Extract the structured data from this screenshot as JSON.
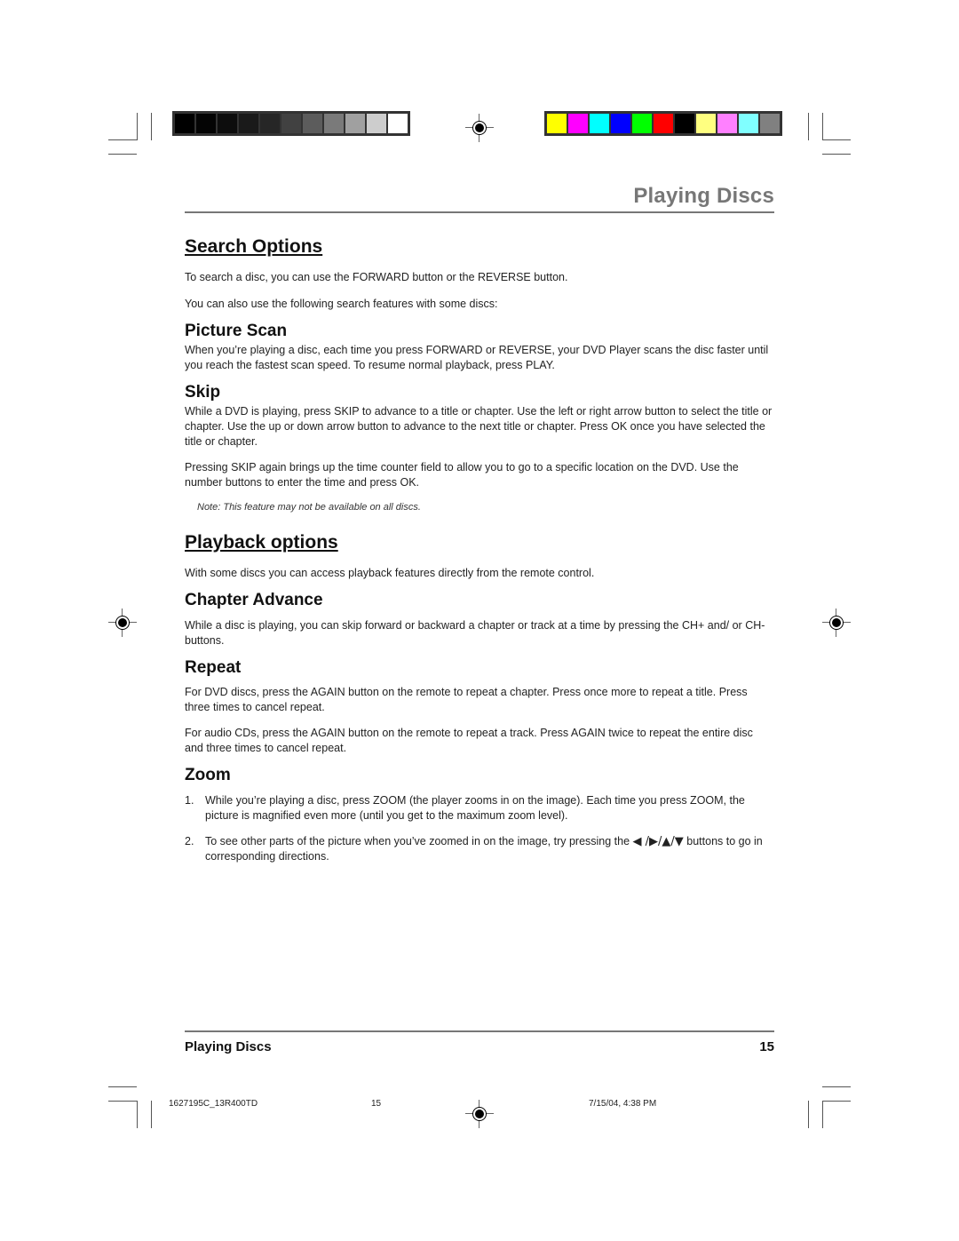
{
  "color_bars": {
    "grayscale": [
      "#000000",
      "#040404",
      "#0d0d0d",
      "#1a1a1a",
      "#262626",
      "#414141",
      "#5c5c5c",
      "#7a7a7a",
      "#a0a0a0",
      "#cdcdcd",
      "#ffffff"
    ],
    "process": [
      "#ffff00",
      "#ff00ff",
      "#00ffff",
      "#0000ff",
      "#00ff00",
      "#ff0000",
      "#000000",
      "#ffff80",
      "#ff80ff",
      "#80ffff",
      "#808080"
    ]
  },
  "header": {
    "running_title": "Playing Discs"
  },
  "sections": {
    "search": {
      "title": "Search Options",
      "intro1": "To search a disc, you can use the FORWARD button or the REVERSE button.",
      "intro2": "You can also use the following search features with some discs:",
      "picture_scan": {
        "title": "Picture Scan",
        "body": "When you’re playing a disc, each time you press FORWARD or REVERSE, your DVD Player scans the disc faster until you reach the fastest scan speed. To resume normal playback, press PLAY."
      },
      "skip": {
        "title": "Skip",
        "body1": "While a DVD is playing, press SKIP to advance to a title or chapter. Use the left or right arrow button to select the title or chapter. Use the up or down arrow button to advance to the next title or chapter. Press OK once you have selected the title or chapter.",
        "body2": "Pressing SKIP again brings up the time counter field to allow you to go to a specific location on the DVD. Use the number buttons to enter the time and press OK.",
        "note": "Note: This feature may not be available on all discs."
      }
    },
    "playback": {
      "title": "Playback options",
      "intro": "With some discs you can access playback features directly from the remote control.",
      "chapter_advance": {
        "title": "Chapter Advance",
        "body": "While a disc is playing, you can skip forward or backward a chapter or track at a time by pressing the CH+ and/ or CH- buttons."
      },
      "repeat": {
        "title": "Repeat",
        "body1": "For DVD discs, press the AGAIN button on the remote to repeat a chapter. Press once more to repeat a title. Press three times to cancel repeat.",
        "body2": "For audio CDs, press the AGAIN button on the remote to repeat a track. Press AGAIN twice to repeat the entire disc and three times to cancel repeat."
      },
      "zoom": {
        "title": "Zoom",
        "items": [
          {
            "num": "1.",
            "text": "While you’re playing a disc, press ZOOM (the player zooms in on the image). Each time you press ZOOM, the picture is magnified even more (until you get to the maximum zoom level)."
          },
          {
            "num": "2.",
            "text_before": "To see other parts of the picture when you’ve zoomed in on the image, try pressing the ",
            "arrows": "◀ /▶/▲/▼",
            "text_after": " buttons to go in corresponding directions."
          }
        ]
      }
    }
  },
  "footer": {
    "title": "Playing Discs",
    "page": "15"
  },
  "slug": {
    "job": "1627195C_13R400TD",
    "page": "15",
    "date": "7/15/04, 4:38 PM"
  }
}
